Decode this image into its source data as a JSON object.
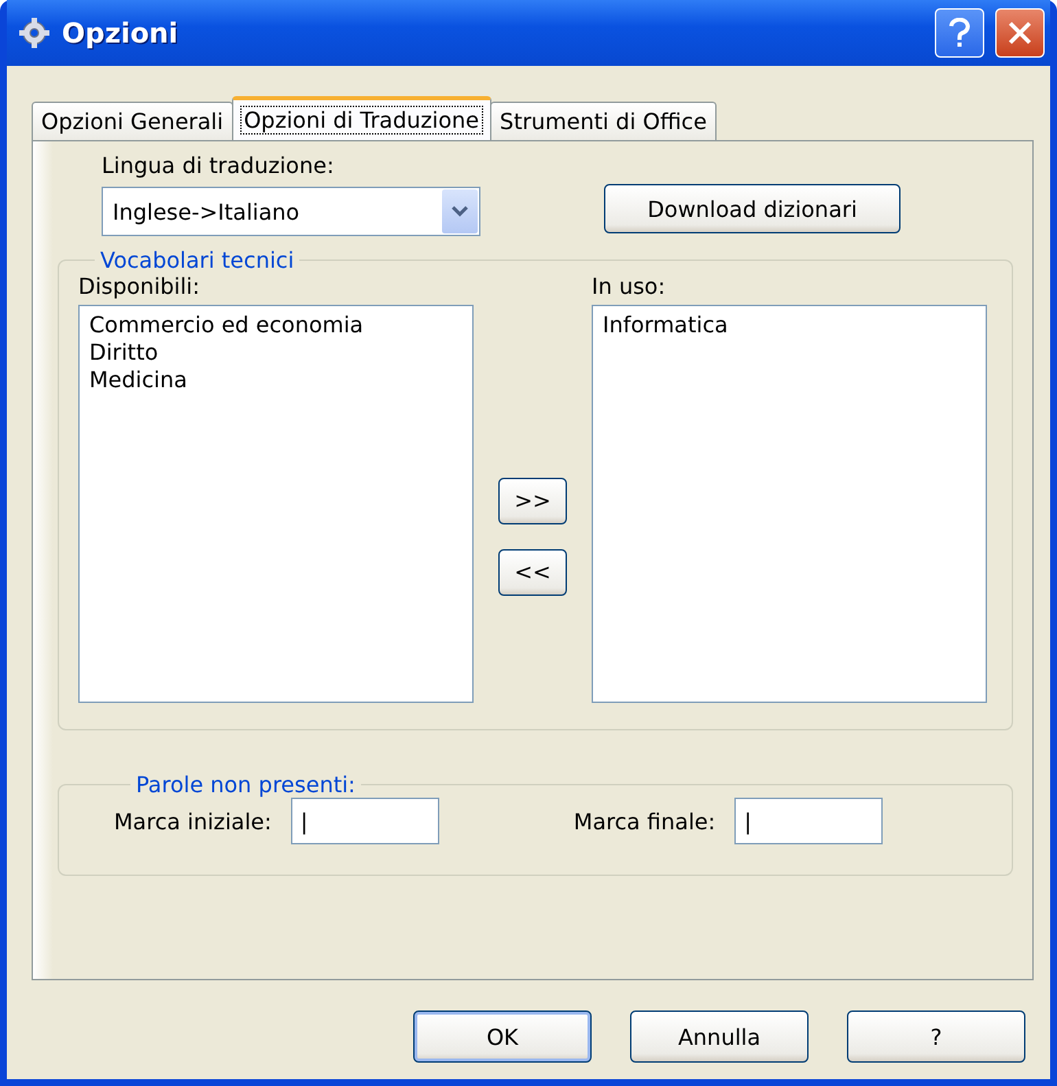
{
  "window": {
    "title": "Opzioni"
  },
  "tabs": [
    {
      "label": "Opzioni Generali",
      "selected": false
    },
    {
      "label": "Opzioni di Traduzione",
      "selected": true
    },
    {
      "label": "Strumenti di Office",
      "selected": false
    }
  ],
  "language": {
    "label": "Lingua di traduzione:",
    "value": "Inglese->Italiano"
  },
  "download_button": "Download dizionari",
  "vocabularies": {
    "title": "Vocabolari tecnici",
    "available_label": "Disponibili:",
    "available": [
      "Commercio ed economia",
      "Diritto",
      "Medicina"
    ],
    "add_button": ">>",
    "remove_button": "<<",
    "in_use_label": "In uso:",
    "in_use": [
      "Informatica"
    ]
  },
  "missing_words": {
    "title": "Parole non presenti:",
    "fields": [
      {
        "label": "Marca iniziale:",
        "value": "|"
      },
      {
        "label": "Marca finale:",
        "value": "|"
      }
    ]
  },
  "buttons": [
    {
      "label": "OK",
      "default": true
    },
    {
      "label": "Annulla",
      "default": false
    },
    {
      "label": "?",
      "default": false
    }
  ]
}
